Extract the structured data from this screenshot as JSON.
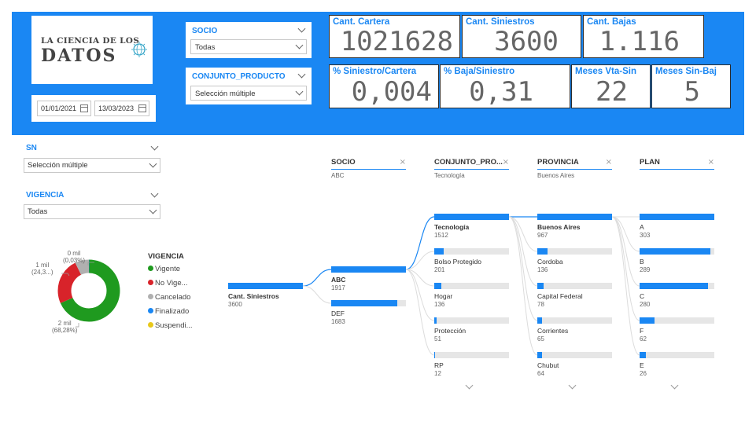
{
  "logo": {
    "line1": "LA CIENCIA DE LOS",
    "line2": "DATOS"
  },
  "date_range": {
    "start": "01/01/2021",
    "end": "13/03/2023"
  },
  "slicers": {
    "socio": {
      "title": "SOCIO",
      "value": "Todas"
    },
    "conjunto_producto": {
      "title": "CONJUNTO_PRODUCTO",
      "value": "Selección múltiple"
    },
    "sn": {
      "title": "SN",
      "value": "Selección múltiple"
    },
    "vigencia": {
      "title": "VIGENCIA",
      "value": "Todas"
    }
  },
  "kpis": {
    "cant_cartera": {
      "title": "Cant. Cartera",
      "value": "1021628"
    },
    "cant_siniestros": {
      "title": "Cant. Siniestros",
      "value": "3600"
    },
    "cant_bajas": {
      "title": "Cant. Bajas",
      "value": "1.116"
    },
    "pct_siniestro_cartera": {
      "title": "% Siniestro/Cartera",
      "value": "0,004"
    },
    "pct_baja_siniestro": {
      "title": "% Baja/Siniestro",
      "value": "0,31"
    },
    "meses_vta_sin": {
      "title": "Meses Vta-Sin",
      "value": "22"
    },
    "meses_sin_baj": {
      "title": "Meses Sin-Baj",
      "value": "5"
    }
  },
  "donut": {
    "labels": {
      "top": {
        "line1": "0 mil",
        "line2": "(0,03%)"
      },
      "left": {
        "line1": "1 mil",
        "line2": "(24,3...)"
      },
      "bottom": {
        "line1": "2 mil",
        "line2": "(68,28%)"
      }
    },
    "legend_title": "VIGENCIA",
    "legend": [
      {
        "label": "Vigente",
        "color": "#1f9a1f"
      },
      {
        "label": "No Vige...",
        "color": "#d8232a"
      },
      {
        "label": "Cancelado",
        "color": "#b0b0b0"
      },
      {
        "label": "Finalizado",
        "color": "#1a87f3"
      },
      {
        "label": "Suspendi...",
        "color": "#e8c81a"
      }
    ],
    "slices": [
      {
        "label": "Vigente",
        "percent": 68.28,
        "color": "#1f9a1f"
      },
      {
        "label": "No Vigente",
        "percent": 24.3,
        "color": "#d8232a"
      },
      {
        "label": "Cancelado",
        "percent": 7.39,
        "color": "#b0b0b0"
      },
      {
        "label": "Finalizado",
        "percent": 0.03,
        "color": "#1a87f3"
      }
    ]
  },
  "decomposition_tree": {
    "root": {
      "label": "Cant. Siniestros",
      "value": "3600"
    },
    "levels": [
      {
        "title": "SOCIO",
        "selected": "ABC",
        "nodes": [
          {
            "label": "ABC",
            "value": "1917",
            "share": 1.0,
            "active": true
          },
          {
            "label": "DEF",
            "value": "1683",
            "share": 0.88,
            "active": false
          }
        ]
      },
      {
        "title": "CONJUNTO_PRO...",
        "selected": "Tecnología",
        "nodes": [
          {
            "label": "Tecnología",
            "value": "1512",
            "share": 1.0,
            "active": true
          },
          {
            "label": "Bolso Protegido",
            "value": "201",
            "share": 0.13,
            "active": false
          },
          {
            "label": "Hogar",
            "value": "136",
            "share": 0.09,
            "active": false
          },
          {
            "label": "Protección",
            "value": "51",
            "share": 0.034,
            "active": false
          },
          {
            "label": "RP",
            "value": "12",
            "share": 0.008,
            "active": false
          }
        ]
      },
      {
        "title": "PROVINCIA",
        "selected": "Buenos Aires",
        "nodes": [
          {
            "label": "Buenos Aires",
            "value": "967",
            "share": 1.0,
            "active": true
          },
          {
            "label": "Cordoba",
            "value": "136",
            "share": 0.14,
            "active": false
          },
          {
            "label": "Capital Federal",
            "value": "78",
            "share": 0.08,
            "active": false
          },
          {
            "label": "Corrientes",
            "value": "65",
            "share": 0.067,
            "active": false
          },
          {
            "label": "Chubut",
            "value": "64",
            "share": 0.066,
            "active": false
          }
        ]
      },
      {
        "title": "PLAN",
        "selected": "",
        "nodes": [
          {
            "label": "A",
            "value": "303",
            "share": 1.0,
            "active": false
          },
          {
            "label": "B",
            "value": "289",
            "share": 0.95,
            "active": false
          },
          {
            "label": "C",
            "value": "280",
            "share": 0.92,
            "active": false
          },
          {
            "label": "F",
            "value": "62",
            "share": 0.2,
            "active": false
          },
          {
            "label": "E",
            "value": "26",
            "share": 0.086,
            "active": false
          }
        ]
      }
    ]
  }
}
